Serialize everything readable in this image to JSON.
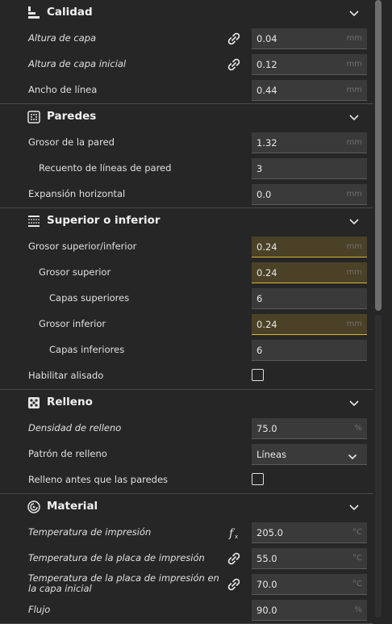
{
  "sections": {
    "calidad": {
      "title": "Calidad",
      "rows": [
        {
          "label": "Altura de capa",
          "value": "0.04",
          "unit": "mm"
        },
        {
          "label": "Altura de capa inicial",
          "value": "0.12",
          "unit": "mm"
        },
        {
          "label": "Ancho de línea",
          "value": "0.44",
          "unit": "mm"
        }
      ]
    },
    "paredes": {
      "title": "Paredes",
      "rows": [
        {
          "label": "Grosor de la pared",
          "value": "1.32",
          "unit": "mm"
        },
        {
          "label": "Recuento de líneas de pared",
          "value": "3",
          "unit": ""
        },
        {
          "label": "Expansión horizontal",
          "value": "0.0",
          "unit": "mm"
        }
      ]
    },
    "superior": {
      "title": "Superior o inferior",
      "rows": [
        {
          "label": "Grosor superior/inferior",
          "value": "0.24",
          "unit": "mm"
        },
        {
          "label": "Grosor superior",
          "value": "0.24",
          "unit": "mm"
        },
        {
          "label": "Capas superiores",
          "value": "6",
          "unit": ""
        },
        {
          "label": "Grosor inferior",
          "value": "0.24",
          "unit": "mm"
        },
        {
          "label": "Capas inferiores",
          "value": "6",
          "unit": ""
        },
        {
          "label": "Habilitar alisado",
          "checked": false
        }
      ]
    },
    "relleno": {
      "title": "Relleno",
      "rows": [
        {
          "label": "Densidad de relleno",
          "value": "75.0",
          "unit": "%"
        },
        {
          "label": "Patrón de relleno",
          "value": "Líneas"
        },
        {
          "label": "Relleno antes que las paredes",
          "checked": false
        }
      ]
    },
    "material": {
      "title": "Material",
      "rows": [
        {
          "label": "Temperatura de impresión",
          "value": "205.0",
          "unit": "°C"
        },
        {
          "label": "Temperatura de la placa de impresión",
          "value": "55.0",
          "unit": "°C"
        },
        {
          "label": "Temperatura de la placa de impresión en la capa inicial",
          "value": "70.0",
          "unit": "°C"
        },
        {
          "label": "Flujo",
          "value": "90.0",
          "unit": "%"
        }
      ]
    }
  },
  "colors": {
    "background": "#262626",
    "field": "#3a3a3a",
    "warning_field": "#4a4126",
    "warning_border": "#d9b53a"
  },
  "icons": {
    "calidad": "quality-icon",
    "paredes": "walls-icon",
    "superior": "top-bottom-icon",
    "relleno": "infill-icon",
    "material": "material-icon",
    "link": "link-icon",
    "function": "function-icon",
    "collapse": "chevron-down-icon"
  }
}
